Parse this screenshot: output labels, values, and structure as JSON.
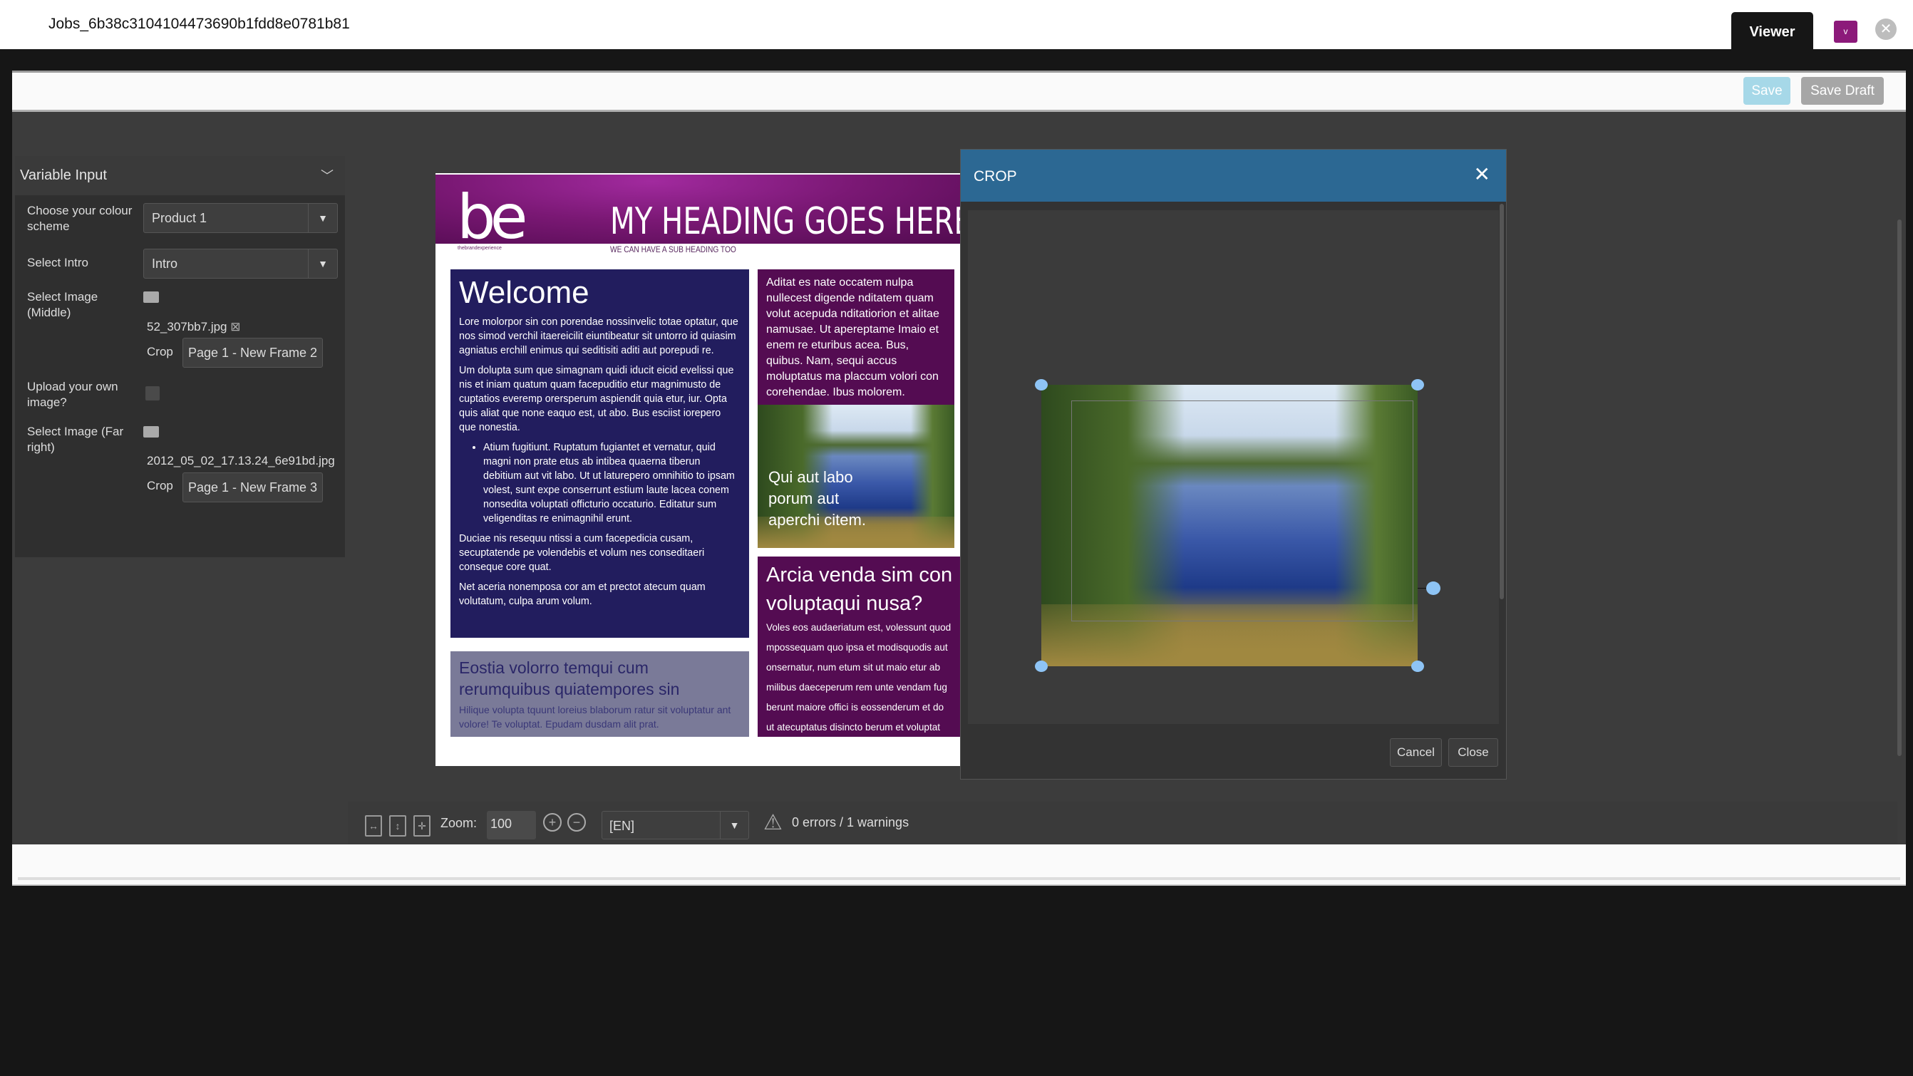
{
  "app": {
    "title": "Jobs_6b38c3104104473690b1fdd8e0781b81",
    "viewer_tab": "Viewer",
    "user_menu": "v"
  },
  "toolbar": {
    "save": "Save",
    "save_draft": "Save Draft"
  },
  "panel": {
    "title": "Variable Input",
    "colour_label": "Choose your colour scheme",
    "colour_value": "Product 1",
    "intro_label": "Select Intro",
    "intro_value": "Intro",
    "image_mid_label": "Select Image (Middle)",
    "image_mid_file": "52_307bb7.jpg",
    "crop_label": "Crop",
    "crop_mid": "Page 1 - New Frame 2",
    "upload_label": "Upload your own image?",
    "upload_checked": false,
    "image_far_label": "Select Image (Far right)",
    "image_far_file": "2012_05_02_17.13.24_6e91bd.jpg",
    "crop_far": "Page 1 - New Frame 3"
  },
  "doc": {
    "logo": "be",
    "logo_sub": "thebrandexperience",
    "heading": "MY HEADING GOES HERE",
    "subheading": "WE CAN HAVE A SUB HEADING TOO",
    "welcome_title": "Welcome",
    "welcome_p1": "Lore molorpor sin con porendae nossinvelic totae optatur, que nos simod verchil itaereicilit eiuntibeatur sit untorro id quiasim agniatus erchill enimus qui seditisiti aditi aut porepudi re.",
    "welcome_p2": "Um dolupta sum que simagnam quidi iducit eicid evelissi que nis et iniam quatum quam facepuditio etur magnimusto de cuptatios everemp orersperum aspiendit quia etur, iur. Opta quis aliat que none eaquo est, ut abo. Bus esciist iorepero que nonestia.",
    "welcome_bullet": "Atium fugitiunt. Ruptatum fugiantet et vernatur, quid magni non prate etus ab intibea quaerna tiberun debitium aut vit labo. Ut ut laturepero omnihitio to ipsam volest, sunt expe conserrunt estium laute lacea conem nonsedita voluptati officturio occaturio. Editatur sum veligenditas re enimagnihil erunt.",
    "welcome_p3": "Duciae nis resequu ntissi a cum facepedicia cusam, secuptatende pe volendebis et volum nes conseditaeri conseque core quat.",
    "welcome_p4": "Net aceria nonemposa cor am et prectot atecum quam volutatum, culpa arum volum.",
    "eostia_title": "Eostia volorro temqui cum rerumquibus quiatempores sin",
    "eostia_text": "Hilique volupta tquunt loreius blaborum ratur sit voluptatur ant volore! Te voluptat. Epudam dusdam alit prat.",
    "aditat_text": "Aditat es nate occatem nulpa nullecest digende nditatem quam volut acepuda nditatiorion et alitae namusae. Ut apereptame Imaio et enem re eturibus acea. Bus, quibus. Nam, sequi accus moluptatus ma placcum volori con corehendae. Ibus molorem.",
    "photo_caption": "Qui aut labo porum aut aperchi citem.",
    "arcia_title_1": "Arcia venda sim con",
    "arcia_title_2": "voluptaqui nusa?",
    "arcia_lines": [
      "Voles eos audaeriatum est, volessunt quod",
      "mpossequam quo ipsa et modisquodis aut",
      "onsernatur, num etum sit ut maio etur ab",
      "milibus daeceperum rem unte vendam fug",
      "berunt maiore offici is eossenderum et do",
      "ut atecuptatus disincto berum et voluptat"
    ]
  },
  "dialog": {
    "title": "CROP",
    "cancel": "Cancel",
    "close": "Close"
  },
  "bottombar": {
    "zoom_label": "Zoom:",
    "zoom_value": "100",
    "language": "[EN]",
    "status": "0 errors / 1 warnings"
  },
  "colors": {
    "accent": "#2c6893",
    "brand_purple": "#540c52",
    "navy": "#221d5e",
    "handle": "#8ec4f5"
  }
}
